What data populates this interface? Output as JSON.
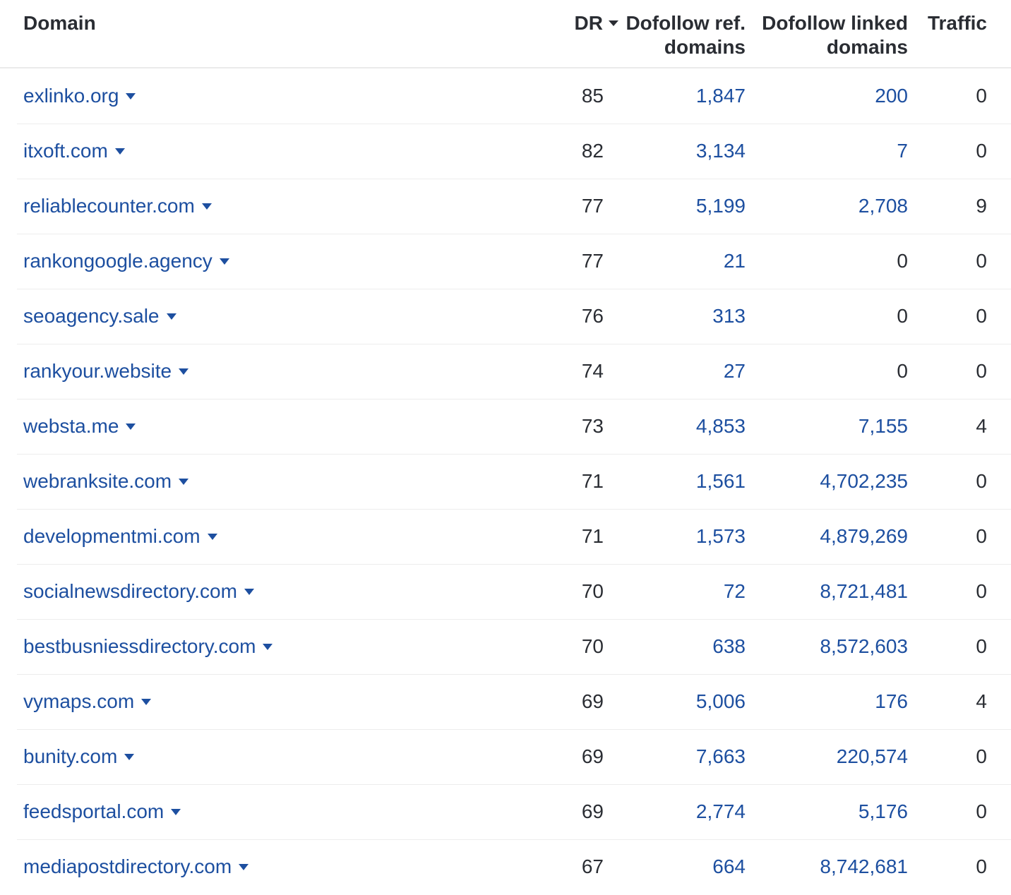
{
  "colors": {
    "link_blue": "#1d4fa0",
    "text_dark": "#2a2d33",
    "header_divider": "#ebebeb",
    "row_divider": "#ededed"
  },
  "table": {
    "columns": [
      {
        "label": "Domain"
      },
      {
        "label": "DR",
        "sort_direction": "desc"
      },
      {
        "label": "Dofollow ref. domains",
        "lines": [
          "Dofollow ref.",
          "domains"
        ]
      },
      {
        "label": "Dofollow linked domains",
        "lines": [
          "Dofollow linked",
          "domains"
        ]
      },
      {
        "label": "Traffic"
      }
    ],
    "rows": [
      {
        "domain": "exlinko.org",
        "dr": "85",
        "dofollow_ref_domains": "1,847",
        "dofollow_linked_domains": "200",
        "traffic": "0"
      },
      {
        "domain": "itxoft.com",
        "dr": "82",
        "dofollow_ref_domains": "3,134",
        "dofollow_linked_domains": "7",
        "traffic": "0"
      },
      {
        "domain": "reliablecounter.com",
        "dr": "77",
        "dofollow_ref_domains": "5,199",
        "dofollow_linked_domains": "2,708",
        "traffic": "9"
      },
      {
        "domain": "rankongoogle.agency",
        "dr": "77",
        "dofollow_ref_domains": "21",
        "dofollow_linked_domains": "0",
        "traffic": "0"
      },
      {
        "domain": "seoagency.sale",
        "dr": "76",
        "dofollow_ref_domains": "313",
        "dofollow_linked_domains": "0",
        "traffic": "0"
      },
      {
        "domain": "rankyour.website",
        "dr": "74",
        "dofollow_ref_domains": "27",
        "dofollow_linked_domains": "0",
        "traffic": "0"
      },
      {
        "domain": "websta.me",
        "dr": "73",
        "dofollow_ref_domains": "4,853",
        "dofollow_linked_domains": "7,155",
        "traffic": "4"
      },
      {
        "domain": "webranksite.com",
        "dr": "71",
        "dofollow_ref_domains": "1,561",
        "dofollow_linked_domains": "4,702,235",
        "traffic": "0"
      },
      {
        "domain": "developmentmi.com",
        "dr": "71",
        "dofollow_ref_domains": "1,573",
        "dofollow_linked_domains": "4,879,269",
        "traffic": "0"
      },
      {
        "domain": "socialnewsdirectory.com",
        "dr": "70",
        "dofollow_ref_domains": "72",
        "dofollow_linked_domains": "8,721,481",
        "traffic": "0"
      },
      {
        "domain": "bestbusniessdirectory.com",
        "dr": "70",
        "dofollow_ref_domains": "638",
        "dofollow_linked_domains": "8,572,603",
        "traffic": "0"
      },
      {
        "domain": "vymaps.com",
        "dr": "69",
        "dofollow_ref_domains": "5,006",
        "dofollow_linked_domains": "176",
        "traffic": "4"
      },
      {
        "domain": "bunity.com",
        "dr": "69",
        "dofollow_ref_domains": "7,663",
        "dofollow_linked_domains": "220,574",
        "traffic": "0"
      },
      {
        "domain": "feedsportal.com",
        "dr": "69",
        "dofollow_ref_domains": "2,774",
        "dofollow_linked_domains": "5,176",
        "traffic": "0"
      },
      {
        "domain": "mediapostdirectory.com",
        "dr": "67",
        "dofollow_ref_domains": "664",
        "dofollow_linked_domains": "8,742,681",
        "traffic": "0"
      }
    ]
  }
}
